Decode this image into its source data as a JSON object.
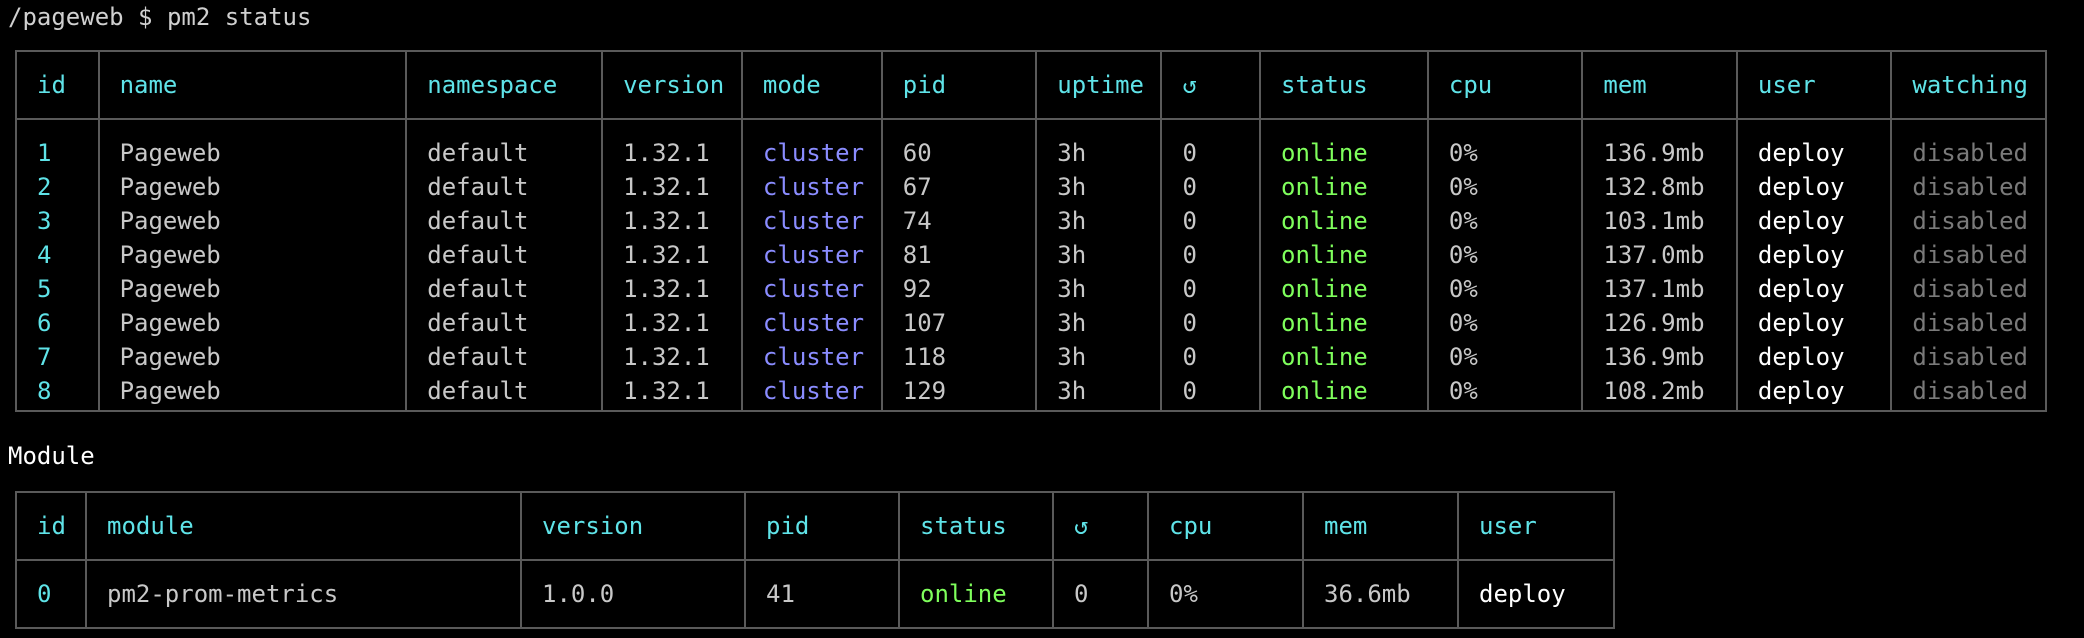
{
  "terminal": {
    "prompt": "/pageweb $ pm2 status"
  },
  "process_table": {
    "headers": {
      "id": "id",
      "name": "name",
      "namespace": "namespace",
      "version": "version",
      "mode": "mode",
      "pid": "pid",
      "uptime": "uptime",
      "restarts": "↺",
      "status": "status",
      "cpu": "cpu",
      "mem": "mem",
      "user": "user",
      "watching": "watching"
    },
    "rows": [
      {
        "id": "1",
        "name": "Pageweb",
        "namespace": "default",
        "version": "1.32.1",
        "mode": "cluster",
        "pid": "60",
        "uptime": "3h",
        "restarts": "0",
        "status": "online",
        "cpu": "0%",
        "mem": "136.9mb",
        "user": "deploy",
        "watching": "disabled"
      },
      {
        "id": "2",
        "name": "Pageweb",
        "namespace": "default",
        "version": "1.32.1",
        "mode": "cluster",
        "pid": "67",
        "uptime": "3h",
        "restarts": "0",
        "status": "online",
        "cpu": "0%",
        "mem": "132.8mb",
        "user": "deploy",
        "watching": "disabled"
      },
      {
        "id": "3",
        "name": "Pageweb",
        "namespace": "default",
        "version": "1.32.1",
        "mode": "cluster",
        "pid": "74",
        "uptime": "3h",
        "restarts": "0",
        "status": "online",
        "cpu": "0%",
        "mem": "103.1mb",
        "user": "deploy",
        "watching": "disabled"
      },
      {
        "id": "4",
        "name": "Pageweb",
        "namespace": "default",
        "version": "1.32.1",
        "mode": "cluster",
        "pid": "81",
        "uptime": "3h",
        "restarts": "0",
        "status": "online",
        "cpu": "0%",
        "mem": "137.0mb",
        "user": "deploy",
        "watching": "disabled"
      },
      {
        "id": "5",
        "name": "Pageweb",
        "namespace": "default",
        "version": "1.32.1",
        "mode": "cluster",
        "pid": "92",
        "uptime": "3h",
        "restarts": "0",
        "status": "online",
        "cpu": "0%",
        "mem": "137.1mb",
        "user": "deploy",
        "watching": "disabled"
      },
      {
        "id": "6",
        "name": "Pageweb",
        "namespace": "default",
        "version": "1.32.1",
        "mode": "cluster",
        "pid": "107",
        "uptime": "3h",
        "restarts": "0",
        "status": "online",
        "cpu": "0%",
        "mem": "126.9mb",
        "user": "deploy",
        "watching": "disabled"
      },
      {
        "id": "7",
        "name": "Pageweb",
        "namespace": "default",
        "version": "1.32.1",
        "mode": "cluster",
        "pid": "118",
        "uptime": "3h",
        "restarts": "0",
        "status": "online",
        "cpu": "0%",
        "mem": "136.9mb",
        "user": "deploy",
        "watching": "disabled"
      },
      {
        "id": "8",
        "name": "Pageweb",
        "namespace": "default",
        "version": "1.32.1",
        "mode": "cluster",
        "pid": "129",
        "uptime": "3h",
        "restarts": "0",
        "status": "online",
        "cpu": "0%",
        "mem": "108.2mb",
        "user": "deploy",
        "watching": "disabled"
      }
    ]
  },
  "module_section": {
    "title": "Module"
  },
  "module_table": {
    "headers": {
      "id": "id",
      "module": "module",
      "version": "version",
      "pid": "pid",
      "status": "status",
      "restarts": "↺",
      "cpu": "cpu",
      "mem": "mem",
      "user": "user"
    },
    "rows": [
      {
        "id": "0",
        "module": "pm2-prom-metrics",
        "version": "1.0.0",
        "pid": "41",
        "status": "online",
        "restarts": "0",
        "cpu": "0%",
        "mem": "36.6mb",
        "user": "deploy"
      }
    ]
  },
  "colors": {
    "background": "#000000",
    "header_text": "#5fe3e8",
    "id_text": "#5fe3e8",
    "mode_cluster": "#8a8cff",
    "status_online": "#7fff5c",
    "user_text": "#ffffff",
    "watching_disabled": "#7a7a7a",
    "border": "#5a5a5a"
  }
}
